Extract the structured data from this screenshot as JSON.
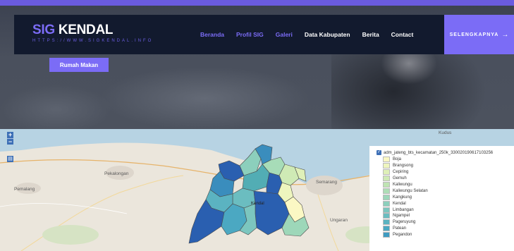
{
  "brand": {
    "name_accent": "SIG",
    "name_rest": " KENDAL",
    "subtitle": "HTTPS://WWW.SIGKENDAL.INFO"
  },
  "nav": {
    "items": [
      {
        "label": "Beranda",
        "active": true
      },
      {
        "label": "Profil SIG",
        "active": true
      },
      {
        "label": "Galeri",
        "active": true
      },
      {
        "label": "Data Kabupaten",
        "active": false
      },
      {
        "label": "Berita",
        "active": false
      },
      {
        "label": "Contact",
        "active": false
      }
    ],
    "cta_label": "SELENGKAPNYA",
    "cta_arrow": "→"
  },
  "hero": {
    "button_label": "Rumah Makan"
  },
  "map": {
    "zoom_in": "+",
    "zoom_out": "−",
    "layers_icon": "layers-icon",
    "places": {
      "pekalongan": "Pekalongan",
      "pemalang": "Pemalang",
      "semarang": "Semarang",
      "kendal": "Kendal",
      "kudus": "Kudus",
      "ungaran": "Ungaran"
    },
    "legend": {
      "layer_name": "adm_jateng_bts_kecamatan_250k_330020190617103256",
      "items": [
        {
          "label": "Boja",
          "color": "#fbf8c4"
        },
        {
          "label": "Brangsong",
          "color": "#eef5be"
        },
        {
          "label": "Cepiring",
          "color": "#dff0b8"
        },
        {
          "label": "Gemuh",
          "color": "#cfeab5"
        },
        {
          "label": "Kaliwungu",
          "color": "#bfe4b3"
        },
        {
          "label": "Kaliwungu Selatan",
          "color": "#aedeb6"
        },
        {
          "label": "Kangkung",
          "color": "#9dd7b9"
        },
        {
          "label": "Kendal",
          "color": "#8ccfbc"
        },
        {
          "label": "Limbangan",
          "color": "#7cc6bf"
        },
        {
          "label": "Ngampel",
          "color": "#6bbdc0"
        },
        {
          "label": "Pageruyung",
          "color": "#5bb3c1"
        },
        {
          "label": "Patean",
          "color": "#4ba8c2"
        },
        {
          "label": "Pegandon",
          "color": "#3f9bc1"
        }
      ]
    },
    "colors": {
      "sea": "#b7d3e3",
      "land": "#ebe6dc",
      "district_dark": "#2a5fb0",
      "district_mid": "#3a8dbd",
      "district_teal": "#52adb4"
    }
  }
}
